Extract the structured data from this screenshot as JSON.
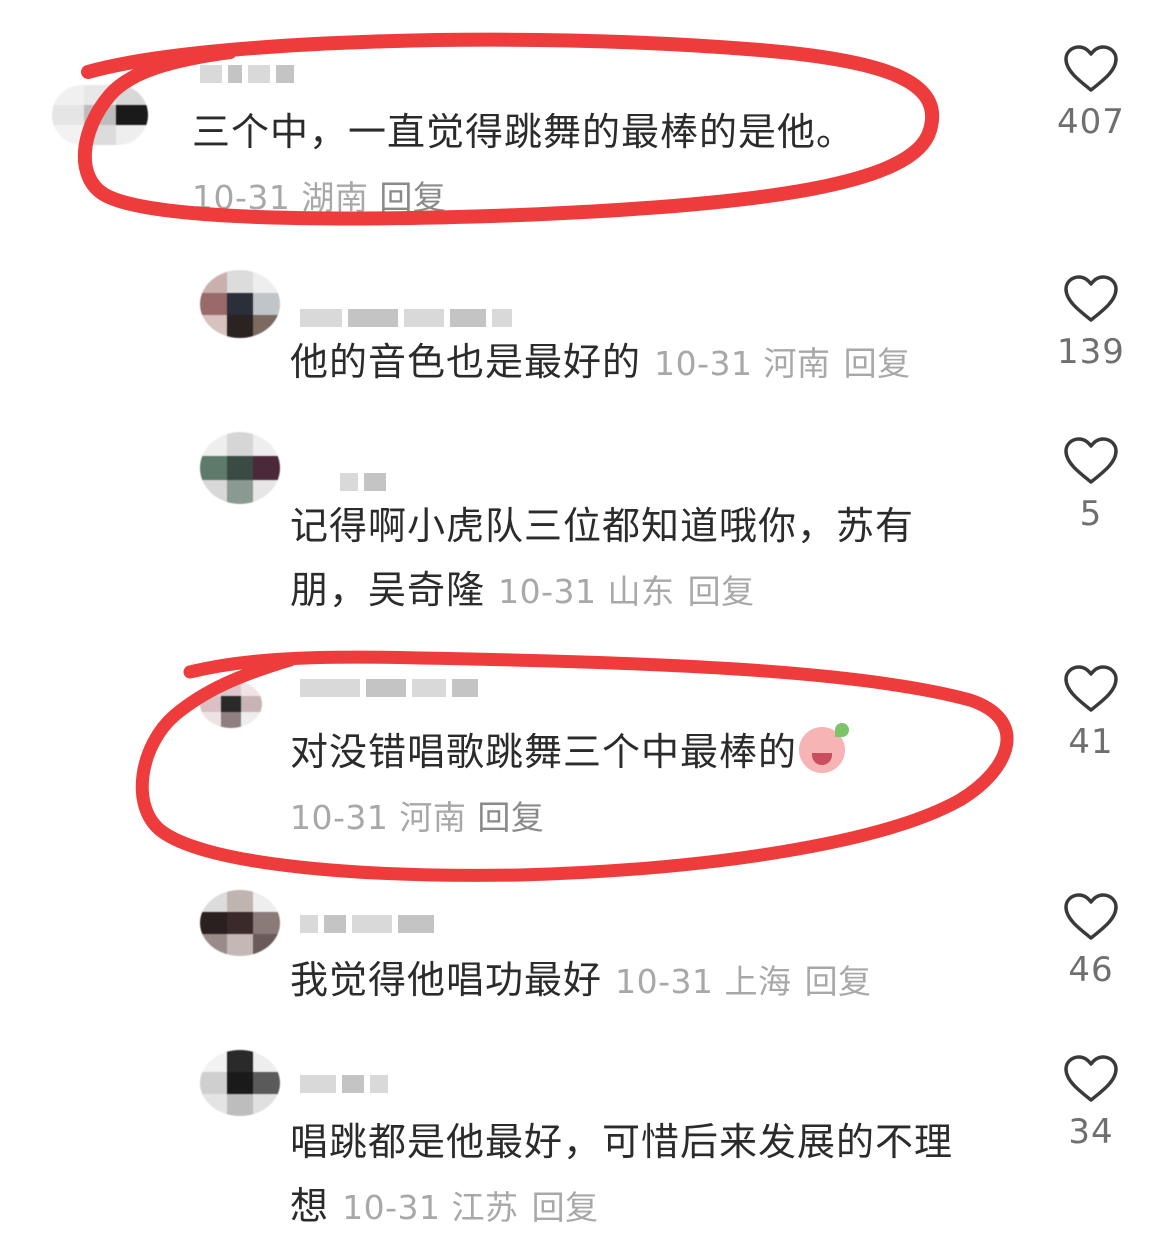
{
  "comments": [
    {
      "text": "三个中，一直觉得跳舞的最棒的是他。",
      "date_location": "10-31 湖南",
      "reply": "回复",
      "likes": "407"
    },
    {
      "text": "他的音色也是最好的",
      "date_location": "10-31 河南",
      "reply": "回复",
      "likes": "139"
    },
    {
      "text_line1": "记得啊小虎队三位都知道哦你，苏有",
      "text_line2": "朋，吴奇隆",
      "date_location": "10-31 山东",
      "reply": "回复",
      "likes": "5"
    },
    {
      "text": "对没错唱歌跳舞三个中最棒的",
      "emoji": "blushing-pig-emoji",
      "date_location": "10-31 河南",
      "reply": "回复",
      "likes": "41"
    },
    {
      "text": "我觉得他唱功最好",
      "date_location": "10-31 上海",
      "reply": "回复",
      "likes": "46"
    },
    {
      "text_line1": "唱跳都是他最好，可惜后来发展的不理",
      "text_line2": "想",
      "date_location": "10-31 江苏",
      "reply": "回复",
      "likes": "34"
    }
  ],
  "icons": {
    "like": "heart-outline-icon"
  },
  "colors": {
    "annotation": "#ee3b3b",
    "meta_text": "#a8a8a8",
    "body_text": "#2b2b2b"
  }
}
